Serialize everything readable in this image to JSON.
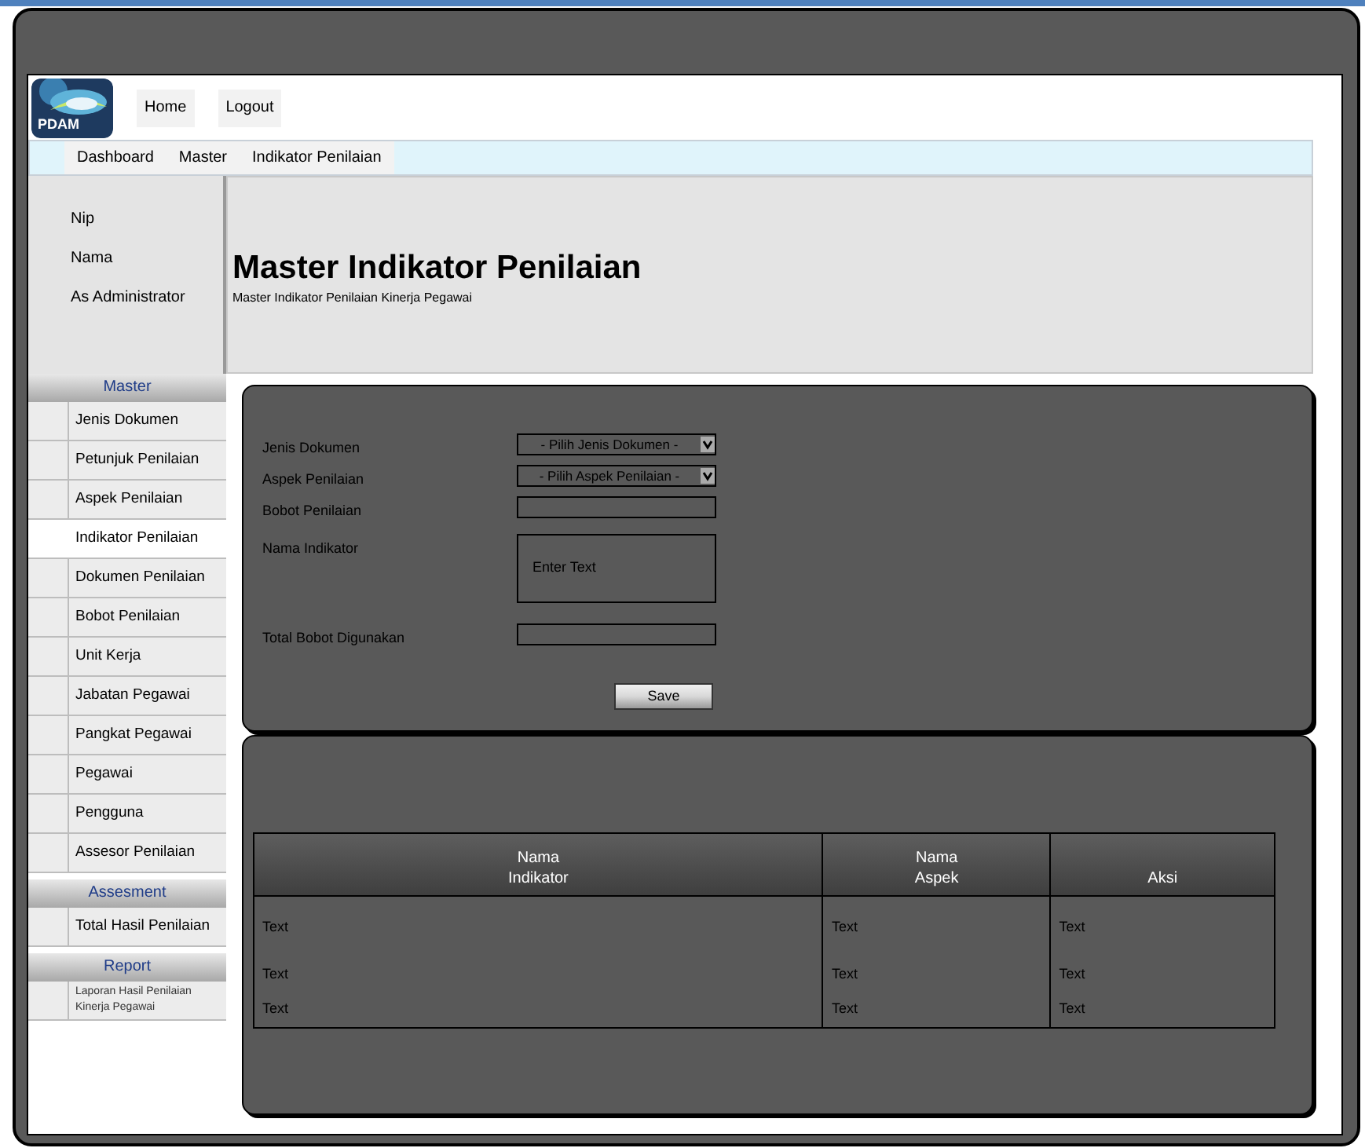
{
  "header": {
    "logo_text": "PDAM",
    "nav": [
      {
        "label": "Home"
      },
      {
        "label": "Logout"
      }
    ]
  },
  "breadcrumb": [
    {
      "label": "Dashboard"
    },
    {
      "label": "Master"
    },
    {
      "label": "Indikator Penilaian"
    }
  ],
  "user_info": [
    "Nip",
    "Nama",
    "As Administrator"
  ],
  "page": {
    "title": "Master Indikator Penilaian",
    "subtitle": "Master Indikator Penilaian Kinerja Pegawai"
  },
  "sidebar": [
    {
      "title": "Master",
      "items": [
        {
          "label": "Jenis Dokumen",
          "selected": false
        },
        {
          "label": "Petunjuk Penilaian",
          "selected": false
        },
        {
          "label": "Aspek Penilaian",
          "selected": false
        },
        {
          "label": "Indikator Penilaian",
          "selected": true
        },
        {
          "label": "Dokumen Penilaian",
          "selected": false
        },
        {
          "label": "Bobot Penilaian",
          "selected": false
        },
        {
          "label": "Unit Kerja",
          "selected": false
        },
        {
          "label": "Jabatan Pegawai",
          "selected": false
        },
        {
          "label": "Pangkat Pegawai",
          "selected": false
        },
        {
          "label": "Pegawai",
          "selected": false
        },
        {
          "label": "Pengguna",
          "selected": false
        },
        {
          "label": "Assesor Penilaian",
          "selected": false
        }
      ]
    },
    {
      "title": "Assesment",
      "items": [
        {
          "label": "Total Hasil Penilaian",
          "selected": false
        }
      ]
    },
    {
      "title": "Report",
      "items": [
        {
          "label": "Laporan Hasil Penilaian Kinerja Pegawai",
          "selected": false
        }
      ]
    }
  ],
  "form": {
    "fields": [
      {
        "kind": "select",
        "label": "Jenis Dokumen",
        "value": "- Pilih Jenis Dokumen -"
      },
      {
        "kind": "select",
        "label": "Aspek Penilaian",
        "value": "- Pilih Aspek Penilaian -"
      },
      {
        "kind": "input",
        "label": "Bobot Penilaian"
      },
      {
        "kind": "textarea",
        "label": "Nama Indikator",
        "placeholder": "Enter Text"
      },
      {
        "kind": "input",
        "label": "Total Bobot Digunakan"
      }
    ],
    "save_button": "Save"
  },
  "table": {
    "columns": [
      "Nama\nIndikator",
      "Nama\nAspek",
      "Aksi"
    ],
    "rows": [
      [
        "Text",
        "Text",
        "Text"
      ],
      [
        "Text",
        "Text",
        "Text"
      ],
      [
        "Text",
        "Text",
        "Text"
      ]
    ]
  }
}
